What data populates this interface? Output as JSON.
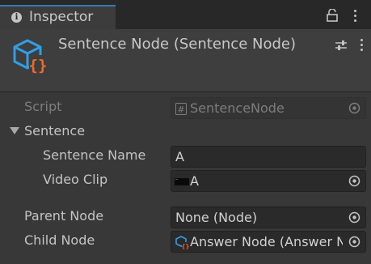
{
  "tab": {
    "label": "Inspector",
    "icon": "info-icon"
  },
  "header": {
    "title": "Sentence Node (Sentence Node)",
    "icon": "script-cube-icon"
  },
  "fields": {
    "script": {
      "label": "Script",
      "value": "SentenceNode"
    },
    "section": {
      "label": "Sentence"
    },
    "sentence_name": {
      "label": "Sentence Name",
      "value": "A"
    },
    "video_clip": {
      "label": "Video Clip",
      "value": "A"
    },
    "parent_node": {
      "label": "Parent Node",
      "value": "None (Node)"
    },
    "child_node": {
      "label": "Child Node",
      "value": "Answer Node (Answer Node)"
    }
  },
  "colors": {
    "accent": "#3a79bb",
    "icon_blue": "#2f9fe6",
    "icon_orange": "#f26b2a",
    "background": "#383838"
  }
}
